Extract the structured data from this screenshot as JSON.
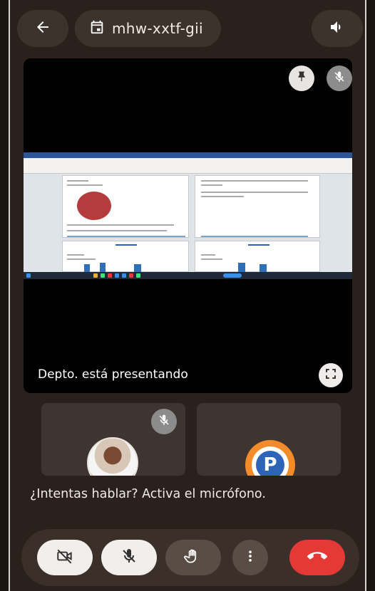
{
  "header": {
    "meeting_code": "mhw-xxtf-gii",
    "icons": [
      "arrow-left-icon",
      "calendar-icon",
      "speaker-icon"
    ]
  },
  "stage": {
    "presenting_text": "Depto. está presentando",
    "icons": [
      "pin-icon",
      "mic-off-icon",
      "fullscreen-icon"
    ]
  },
  "participants": [
    {
      "type": "photo-avatar",
      "muted": true
    },
    {
      "type": "logo-avatar",
      "logo_letter": "P"
    }
  ],
  "hint": "¿Intentas hablar? Activa el micrófono.",
  "controls": {
    "icons": [
      "camera-off-icon",
      "mic-off-icon",
      "hand-raise-icon",
      "more-vert-icon",
      "call-end-icon"
    ]
  },
  "colors": {
    "background": "#2a211c",
    "pill": "#3d332d",
    "end_call": "#e53935",
    "logo_orange": "#f28c2a",
    "logo_blue": "#2d64b8"
  }
}
